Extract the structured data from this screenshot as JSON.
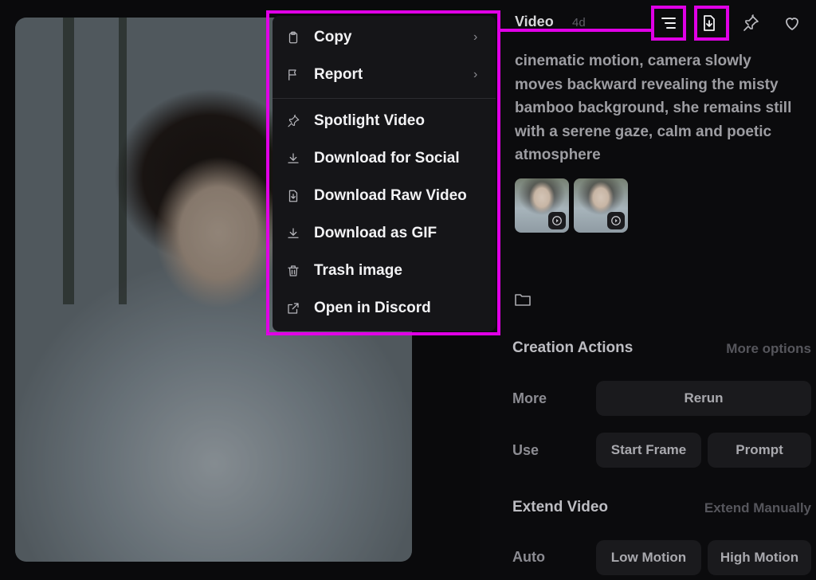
{
  "header": {
    "title": "Video",
    "age": "4d"
  },
  "prompt_text": "cinematic motion, camera slowly moves backward revealing the misty bamboo background, she remains still with a serene gaze, calm and poetic atmosphere",
  "menu": {
    "items": [
      {
        "label": "Copy",
        "icon": "clipboard-icon",
        "submenu": true
      },
      {
        "label": "Report",
        "icon": "flag-icon",
        "submenu": true
      },
      {
        "label": "Spotlight Video",
        "icon": "pin-icon"
      },
      {
        "label": "Download for Social",
        "icon": "download-icon"
      },
      {
        "label": "Download Raw Video",
        "icon": "file-download-icon"
      },
      {
        "label": "Download as GIF",
        "icon": "download-icon"
      },
      {
        "label": "Trash image",
        "icon": "trash-icon"
      },
      {
        "label": "Open in Discord",
        "icon": "external-link-icon"
      }
    ],
    "chevron": "›"
  },
  "creation_actions": {
    "title": "Creation Actions",
    "more_options": "More options",
    "more_label": "More",
    "rerun": "Rerun",
    "use_label": "Use",
    "start_frame": "Start Frame",
    "prompt_button": "Prompt"
  },
  "extend_video": {
    "title": "Extend Video",
    "extend_manually": "Extend Manually",
    "auto_label": "Auto",
    "low_motion": "Low Motion",
    "high_motion": "High Motion"
  },
  "colors": {
    "highlight": "#e000e6",
    "menu_bg": "#151518",
    "button_bg": "#1a1a1d"
  }
}
